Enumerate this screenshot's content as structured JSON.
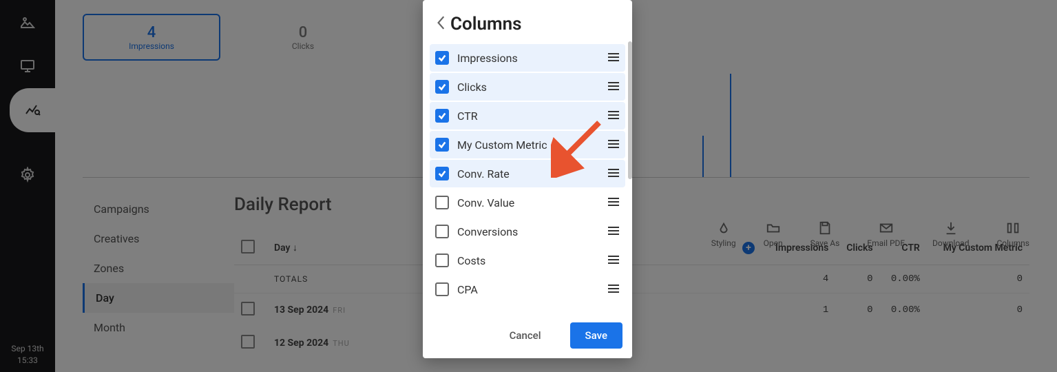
{
  "sidebar": {
    "icons": [
      "image-icon",
      "desktop-icon",
      "analytics-icon",
      "gear-icon"
    ],
    "active_index": 2,
    "footer_date": "Sep 13th",
    "footer_time": "15:33"
  },
  "metrics": [
    {
      "value": "4",
      "label": "Impressions",
      "active": true
    },
    {
      "value": "0",
      "label": "Clicks",
      "active": false
    }
  ],
  "left_tabs": {
    "items": [
      "Campaigns",
      "Creatives",
      "Zones",
      "Day",
      "Month"
    ],
    "active_index": 3
  },
  "report": {
    "title": "Daily Report",
    "toolbar": [
      {
        "name": "styling",
        "label": "Styling"
      },
      {
        "name": "open",
        "label": "Open"
      },
      {
        "name": "save-as",
        "label": "Save As"
      },
      {
        "name": "email-pdf",
        "label": "Email PDF"
      },
      {
        "name": "download",
        "label": "Download"
      },
      {
        "name": "columns",
        "label": "Columns"
      }
    ],
    "columns": [
      "Day ↓",
      "Impressions",
      "Clicks",
      "CTR",
      "My Custom Metric"
    ],
    "totals_label": "TOTALS",
    "totals": {
      "impressions": "4",
      "clicks": "0",
      "ctr": "0.00%",
      "custom": "0"
    },
    "rows": [
      {
        "date": "13 Sep 2024",
        "dow": "FRI",
        "impressions": "1",
        "clicks": "0",
        "ctr": "0.00%",
        "custom": "0"
      },
      {
        "date": "12 Sep 2024",
        "dow": "THU",
        "impressions": "",
        "clicks": "",
        "ctr": "",
        "custom": ""
      }
    ]
  },
  "modal": {
    "title": "Columns",
    "items": [
      {
        "label": "Impressions",
        "checked": true
      },
      {
        "label": "Clicks",
        "checked": true
      },
      {
        "label": "CTR",
        "checked": true
      },
      {
        "label": "My Custom Metric",
        "checked": true
      },
      {
        "label": "Conv. Rate",
        "checked": true
      },
      {
        "label": "Conv. Value",
        "checked": false
      },
      {
        "label": "Conversions",
        "checked": false
      },
      {
        "label": "Costs",
        "checked": false
      },
      {
        "label": "CPA",
        "checked": false
      }
    ],
    "cancel_label": "Cancel",
    "save_label": "Save"
  }
}
